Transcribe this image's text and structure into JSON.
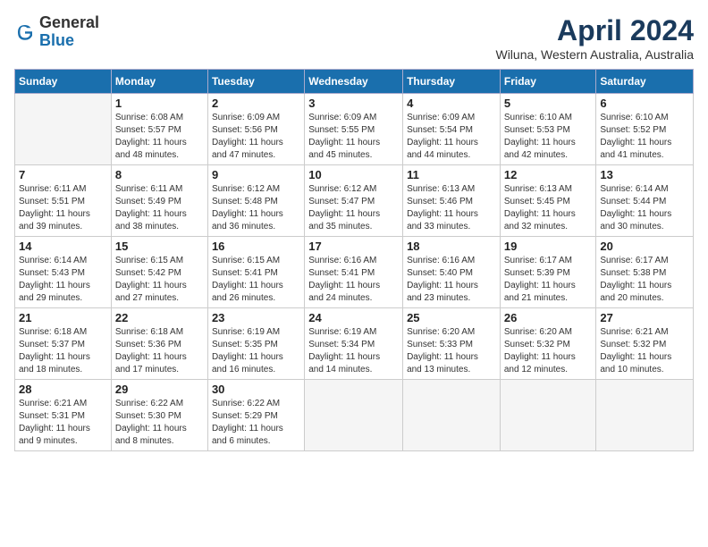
{
  "header": {
    "logo_general": "General",
    "logo_blue": "Blue",
    "month_title": "April 2024",
    "subtitle": "Wiluna, Western Australia, Australia"
  },
  "days_of_week": [
    "Sunday",
    "Monday",
    "Tuesday",
    "Wednesday",
    "Thursday",
    "Friday",
    "Saturday"
  ],
  "weeks": [
    [
      {
        "day": "",
        "info": ""
      },
      {
        "day": "1",
        "info": "Sunrise: 6:08 AM\nSunset: 5:57 PM\nDaylight: 11 hours\nand 48 minutes."
      },
      {
        "day": "2",
        "info": "Sunrise: 6:09 AM\nSunset: 5:56 PM\nDaylight: 11 hours\nand 47 minutes."
      },
      {
        "day": "3",
        "info": "Sunrise: 6:09 AM\nSunset: 5:55 PM\nDaylight: 11 hours\nand 45 minutes."
      },
      {
        "day": "4",
        "info": "Sunrise: 6:09 AM\nSunset: 5:54 PM\nDaylight: 11 hours\nand 44 minutes."
      },
      {
        "day": "5",
        "info": "Sunrise: 6:10 AM\nSunset: 5:53 PM\nDaylight: 11 hours\nand 42 minutes."
      },
      {
        "day": "6",
        "info": "Sunrise: 6:10 AM\nSunset: 5:52 PM\nDaylight: 11 hours\nand 41 minutes."
      }
    ],
    [
      {
        "day": "7",
        "info": "Sunrise: 6:11 AM\nSunset: 5:51 PM\nDaylight: 11 hours\nand 39 minutes."
      },
      {
        "day": "8",
        "info": "Sunrise: 6:11 AM\nSunset: 5:49 PM\nDaylight: 11 hours\nand 38 minutes."
      },
      {
        "day": "9",
        "info": "Sunrise: 6:12 AM\nSunset: 5:48 PM\nDaylight: 11 hours\nand 36 minutes."
      },
      {
        "day": "10",
        "info": "Sunrise: 6:12 AM\nSunset: 5:47 PM\nDaylight: 11 hours\nand 35 minutes."
      },
      {
        "day": "11",
        "info": "Sunrise: 6:13 AM\nSunset: 5:46 PM\nDaylight: 11 hours\nand 33 minutes."
      },
      {
        "day": "12",
        "info": "Sunrise: 6:13 AM\nSunset: 5:45 PM\nDaylight: 11 hours\nand 32 minutes."
      },
      {
        "day": "13",
        "info": "Sunrise: 6:14 AM\nSunset: 5:44 PM\nDaylight: 11 hours\nand 30 minutes."
      }
    ],
    [
      {
        "day": "14",
        "info": "Sunrise: 6:14 AM\nSunset: 5:43 PM\nDaylight: 11 hours\nand 29 minutes."
      },
      {
        "day": "15",
        "info": "Sunrise: 6:15 AM\nSunset: 5:42 PM\nDaylight: 11 hours\nand 27 minutes."
      },
      {
        "day": "16",
        "info": "Sunrise: 6:15 AM\nSunset: 5:41 PM\nDaylight: 11 hours\nand 26 minutes."
      },
      {
        "day": "17",
        "info": "Sunrise: 6:16 AM\nSunset: 5:41 PM\nDaylight: 11 hours\nand 24 minutes."
      },
      {
        "day": "18",
        "info": "Sunrise: 6:16 AM\nSunset: 5:40 PM\nDaylight: 11 hours\nand 23 minutes."
      },
      {
        "day": "19",
        "info": "Sunrise: 6:17 AM\nSunset: 5:39 PM\nDaylight: 11 hours\nand 21 minutes."
      },
      {
        "day": "20",
        "info": "Sunrise: 6:17 AM\nSunset: 5:38 PM\nDaylight: 11 hours\nand 20 minutes."
      }
    ],
    [
      {
        "day": "21",
        "info": "Sunrise: 6:18 AM\nSunset: 5:37 PM\nDaylight: 11 hours\nand 18 minutes."
      },
      {
        "day": "22",
        "info": "Sunrise: 6:18 AM\nSunset: 5:36 PM\nDaylight: 11 hours\nand 17 minutes."
      },
      {
        "day": "23",
        "info": "Sunrise: 6:19 AM\nSunset: 5:35 PM\nDaylight: 11 hours\nand 16 minutes."
      },
      {
        "day": "24",
        "info": "Sunrise: 6:19 AM\nSunset: 5:34 PM\nDaylight: 11 hours\nand 14 minutes."
      },
      {
        "day": "25",
        "info": "Sunrise: 6:20 AM\nSunset: 5:33 PM\nDaylight: 11 hours\nand 13 minutes."
      },
      {
        "day": "26",
        "info": "Sunrise: 6:20 AM\nSunset: 5:32 PM\nDaylight: 11 hours\nand 12 minutes."
      },
      {
        "day": "27",
        "info": "Sunrise: 6:21 AM\nSunset: 5:32 PM\nDaylight: 11 hours\nand 10 minutes."
      }
    ],
    [
      {
        "day": "28",
        "info": "Sunrise: 6:21 AM\nSunset: 5:31 PM\nDaylight: 11 hours\nand 9 minutes."
      },
      {
        "day": "29",
        "info": "Sunrise: 6:22 AM\nSunset: 5:30 PM\nDaylight: 11 hours\nand 8 minutes."
      },
      {
        "day": "30",
        "info": "Sunrise: 6:22 AM\nSunset: 5:29 PM\nDaylight: 11 hours\nand 6 minutes."
      },
      {
        "day": "",
        "info": ""
      },
      {
        "day": "",
        "info": ""
      },
      {
        "day": "",
        "info": ""
      },
      {
        "day": "",
        "info": ""
      }
    ]
  ]
}
